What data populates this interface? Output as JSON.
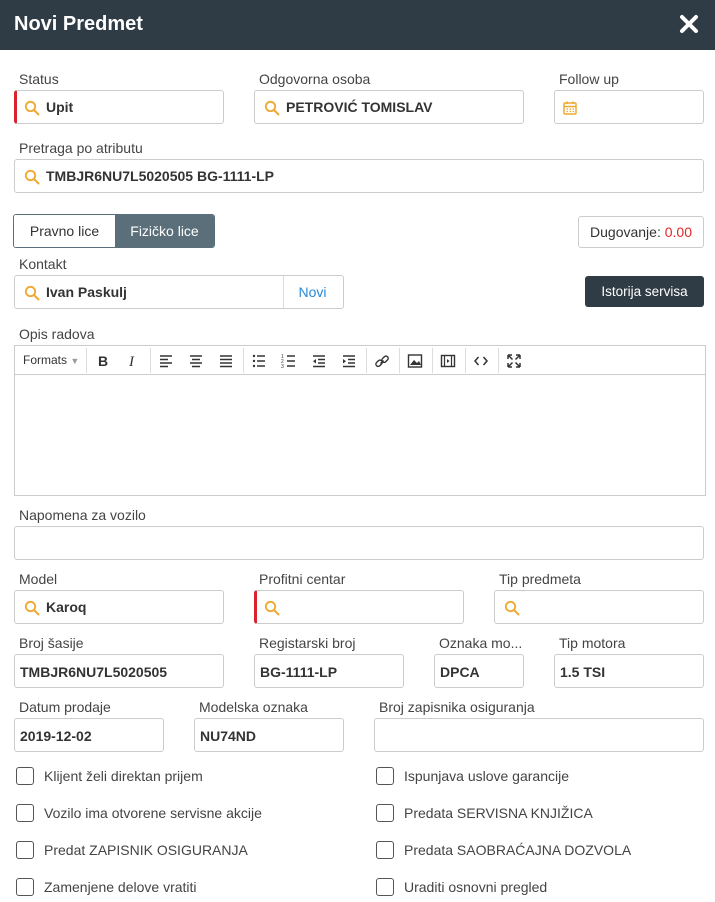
{
  "dialog": {
    "title": "Novi Predmet"
  },
  "status": {
    "label": "Status",
    "value": "Upit"
  },
  "odgovorna": {
    "label": "Odgovorna osoba",
    "value": "PETROVIĆ TOMISLAV"
  },
  "followup": {
    "label": "Follow up",
    "value": ""
  },
  "pretraga": {
    "label": "Pretraga po atributu",
    "value": "TMBJR6NU7L5020505 BG-1111-LP"
  },
  "tip_lica": {
    "pravno": "Pravno lice",
    "fizicko": "Fizičko lice",
    "selected": "Fizičko lice"
  },
  "dugovanje": {
    "label": "Dugovanje:",
    "value": "0.00"
  },
  "kontakt": {
    "label": "Kontakt",
    "value": "Ivan Paskulj",
    "novi": "Novi"
  },
  "istorija_button": "Istorija servisa",
  "opis": {
    "label": "Opis radova",
    "formats": "Formats",
    "content": ""
  },
  "napomena": {
    "label": "Napomena za vozilo",
    "value": ""
  },
  "model": {
    "label": "Model",
    "value": "Karoq"
  },
  "profitni": {
    "label": "Profitni centar",
    "value": ""
  },
  "tip_predmeta": {
    "label": "Tip predmeta",
    "value": ""
  },
  "broj_sasije": {
    "label": "Broj šasije",
    "value": "TMBJR6NU7L5020505"
  },
  "registarski": {
    "label": "Registarski broj",
    "value": "BG-1111-LP"
  },
  "oznaka_motora": {
    "label": "Oznaka mo...",
    "value": "DPCA"
  },
  "tip_motora": {
    "label": "Tip motora",
    "value": "1.5 TSI"
  },
  "datum_prodaje": {
    "label": "Datum prodaje",
    "value": "2019-12-02"
  },
  "modelska": {
    "label": "Modelska oznaka",
    "value": "NU74ND"
  },
  "zapisnik": {
    "label": "Broj zapisnika osiguranja",
    "value": ""
  },
  "checkboxes": {
    "c1": {
      "label": "Klijent želi direktan prijem",
      "checked": false
    },
    "c2": {
      "label": "Ispunjava uslove garancije",
      "checked": false
    },
    "c3": {
      "label": "Vozilo ima otvorene servisne akcije",
      "checked": false
    },
    "c4": {
      "label": "Predata SERVISNA KNJIŽICA",
      "checked": false
    },
    "c5": {
      "label": "Predat ZAPISNIK OSIGURANJA",
      "checked": false
    },
    "c6": {
      "label": "Predata SAOBRAĆAJNA DOZVOLA",
      "checked": false
    },
    "c7": {
      "label": "Zamenjene delove vratiti",
      "checked": false
    },
    "c8": {
      "label": "Uraditi osnovni pregled",
      "checked": false
    }
  },
  "colors": {
    "header": "#2f3c45",
    "accent_icon": "#f0a830",
    "required": "#d9232d",
    "link": "#2a8ad4",
    "debt": "#e12727"
  }
}
